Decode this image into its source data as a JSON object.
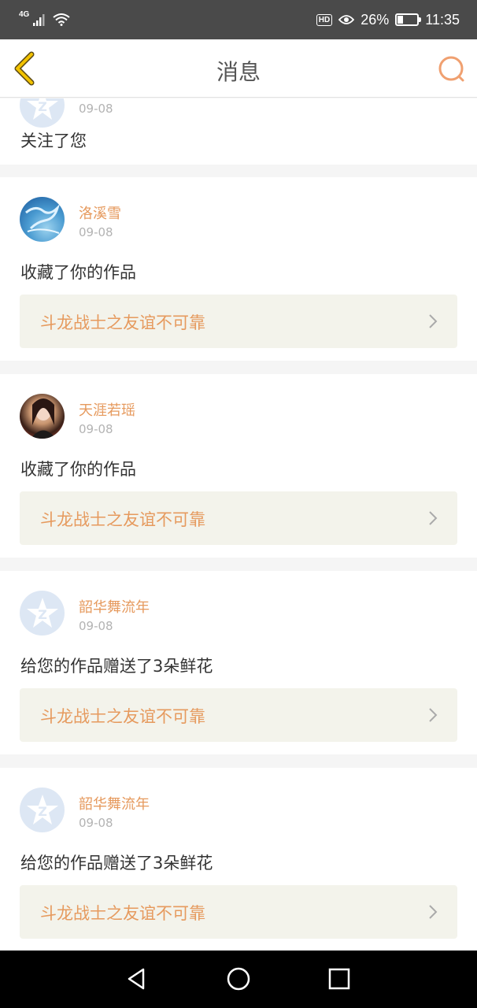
{
  "status_bar": {
    "network": "4G",
    "hd": "HD",
    "battery_percent": "26%",
    "battery_level": 0.26,
    "time": "11:35"
  },
  "nav": {
    "title": "消息",
    "back_icon": "chevron-left-icon",
    "search_icon": "search-icon"
  },
  "accent_color": "#e69a5e",
  "messages": [
    {
      "username": "",
      "date": "09-08",
      "action": "关注了您",
      "avatar": "default"
    },
    {
      "username": "洛溪雪",
      "date": "09-08",
      "action": "收藏了你的作品",
      "work": "斗龙战士之友谊不可靠",
      "avatar": "dragon"
    },
    {
      "username": "天涯若瑶",
      "date": "09-08",
      "action": "收藏了你的作品",
      "work": "斗龙战士之友谊不可靠",
      "avatar": "girl"
    },
    {
      "username": "韶华舞流年",
      "date": "09-08",
      "action": "给您的作品赠送了3朵鲜花",
      "work": "斗龙战士之友谊不可靠",
      "avatar": "default"
    },
    {
      "username": "韶华舞流年",
      "date": "09-08",
      "action": "给您的作品赠送了3朵鲜花",
      "work": "斗龙战士之友谊不可靠",
      "avatar": "default"
    }
  ]
}
